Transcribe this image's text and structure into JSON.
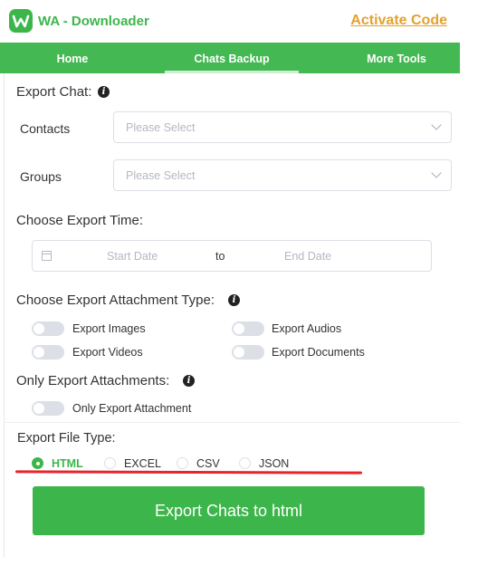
{
  "header": {
    "app_title": "WA - Downloader",
    "activate_label": "Activate Code",
    "logo_letter": "W",
    "brand_color": "#3cb64a",
    "activate_color": "#e4a12d"
  },
  "nav": {
    "tabs": [
      {
        "label": "Home"
      },
      {
        "label": "Chats Backup"
      },
      {
        "label": "More Tools"
      }
    ],
    "active_tab": "Chats Backup"
  },
  "export_chat": {
    "title": "Export Chat:",
    "contacts_label": "Contacts",
    "contacts_placeholder": "Please Select",
    "groups_label": "Groups",
    "groups_placeholder": "Please Select"
  },
  "export_time": {
    "title": "Choose Export Time:",
    "start_placeholder": "Start Date",
    "separator": "to",
    "end_placeholder": "End Date"
  },
  "attachments": {
    "title": "Choose Export Attachment Type:",
    "options": [
      {
        "label": "Export Images",
        "on": false
      },
      {
        "label": "Export Audios",
        "on": false
      },
      {
        "label": "Export Videos",
        "on": false
      },
      {
        "label": "Export Documents",
        "on": false
      }
    ]
  },
  "only_attachments": {
    "title": "Only Export Attachments:",
    "option_label": "Only Export Attachment",
    "on": false
  },
  "file_type": {
    "title": "Export File Type:",
    "options": [
      "HTML",
      "EXCEL",
      "CSV",
      "JSON"
    ],
    "selected": "HTML"
  },
  "export_button_label": "Export Chats to html",
  "colors": {
    "accent": "#3cb64a",
    "underline_annotation": "#e8242b"
  }
}
